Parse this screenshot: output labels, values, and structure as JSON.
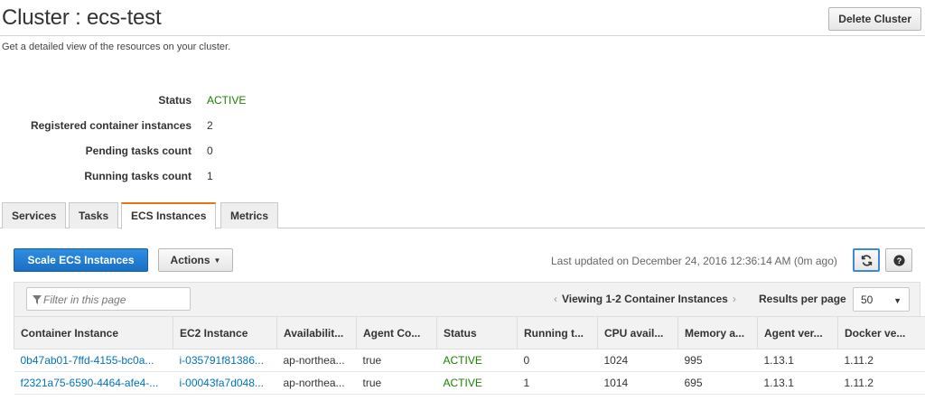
{
  "header": {
    "title": "Cluster : ecs-test",
    "delete_label": "Delete Cluster",
    "description": "Get a detailed view of the resources on your cluster."
  },
  "summary": [
    {
      "label": "Status",
      "value": "ACTIVE"
    },
    {
      "label": "Registered container instances",
      "value": "2"
    },
    {
      "label": "Pending tasks count",
      "value": "0"
    },
    {
      "label": "Running tasks count",
      "value": "1"
    }
  ],
  "tabs": [
    {
      "label": "Services"
    },
    {
      "label": "Tasks"
    },
    {
      "label": "ECS Instances",
      "active": true
    },
    {
      "label": "Metrics"
    }
  ],
  "toolbar": {
    "scale_label": "Scale ECS Instances",
    "actions_label": "Actions",
    "last_updated": "Last updated on December 24, 2016 12:36:14 AM (0m ago)"
  },
  "filter": {
    "placeholder": "Filter in this page",
    "viewing": "Viewing 1-2 Container Instances",
    "results_per_page_label": "Results per page",
    "results_per_page": "50"
  },
  "table": {
    "columns": [
      "Container Instance",
      "EC2 Instance",
      "Availabilit...",
      "Agent Co...",
      "Status",
      "Running t...",
      "CPU avail...",
      "Memory a...",
      "Agent ver...",
      "Docker ve..."
    ],
    "rows": [
      [
        "0b47ab01-7ffd-4155-bc0a...",
        "i-035791f81386...",
        "ap-northea...",
        "true",
        "ACTIVE",
        "0",
        "1024",
        "995",
        "1.13.1",
        "1.11.2"
      ],
      [
        "f2321a75-6590-4464-afe4-...",
        "i-00043fa7d048...",
        "ap-northea...",
        "true",
        "ACTIVE",
        "1",
        "1014",
        "695",
        "1.13.1",
        "1.11.2"
      ]
    ]
  },
  "colors": {
    "primary": "#1a6fc4",
    "link": "#0073bb",
    "active_status": "#1d8102",
    "tab_accent": "#ec7211"
  }
}
